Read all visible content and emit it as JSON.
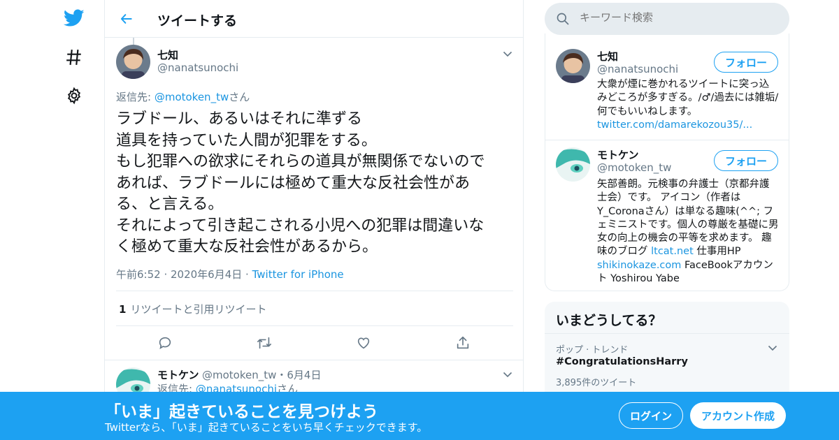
{
  "colors": {
    "brand": "#1da1f2",
    "link": "#1b95e0",
    "muted": "#657786",
    "border": "#e6ecf0"
  },
  "nav": {
    "icons": [
      "twitter-bird-icon",
      "hashtag-icon",
      "gear-icon"
    ]
  },
  "header": {
    "title": "ツイートする"
  },
  "tweet": {
    "name": "七知",
    "handle": "@nanatsunochi",
    "reply_prefix": "返信先: ",
    "reply_handle": "@motoken_tw",
    "reply_suffix": "さん",
    "text": "ラブドール、あるいはそれに準ずる\n道具を持っていた人間が犯罪をする。\nもし犯罪への欲求にそれらの道具が無関係でないので\nあれば、ラブドールには極めて重大な反社会性があ\nる、と言える。\nそれによって引き起こされる小児への犯罪は間違いな\nく極めて重大な反社会性があるから。",
    "time": "午前6:52",
    "date": "2020年6月4日",
    "source": "Twitter for iPhone",
    "retweet_count": "1",
    "retweet_label": "リツイートと引用リツイート"
  },
  "reply": {
    "name": "モトケン",
    "handle_date": "@motoken_tw・6月4日",
    "reply_prefix": "返信先: ",
    "reply_handle": "@nanatsunochi",
    "reply_suffix": "さん"
  },
  "search": {
    "placeholder": "キーワード検索"
  },
  "users": [
    {
      "name": "七知",
      "handle": "@nanatsunochi",
      "follow": "フォロー",
      "bio_line1": "大衆が煙に巻かれるツイートに突っ込みどころが多すぎる。/♂/過去には雑垢/何でもいいねします。",
      "link": "twitter.com/damarekozou35/..."
    },
    {
      "name": "モトケン",
      "handle": "@motoken_tw",
      "follow": "フォロー",
      "bio_text": "矢部善朗。元検事の弁護士（京都弁護士会）です。 アイコン（作者は Y_Coronaさん）は単なる趣味(^^; フェミニストです。個人の尊厳を基礎に男女の向上の機会の平等を求めます。 趣味のブログ ",
      "link1": "ltcat.net",
      "mid": " 仕事用HP ",
      "link2": "shikinokaze.com",
      "tail": " FaceBookアカウント Yoshirou Yabe"
    }
  ],
  "trends": {
    "title": "いまどうしてる？",
    "category": "ポップ · トレンド",
    "name": "#CongratulationsHarry",
    "count": "3,895件のツイート"
  },
  "banner": {
    "title": "「いま」起きていることを見つけよう",
    "subtitle": "Twitterなら、「いま」起きていることをいち早くチェックできます。",
    "login": "ログイン",
    "signup": "アカウント作成"
  }
}
